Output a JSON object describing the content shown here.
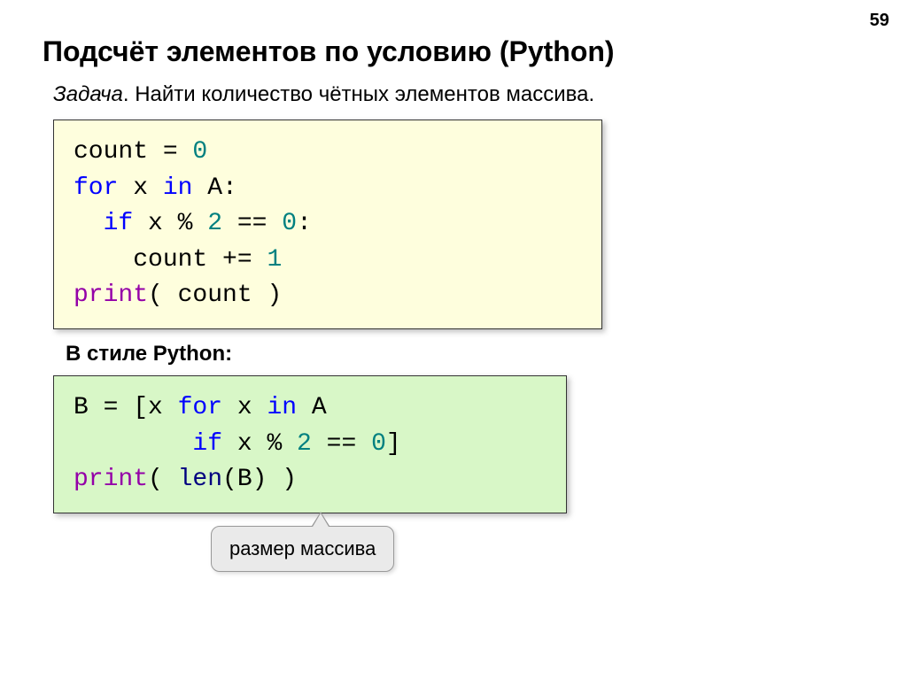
{
  "pageNumber": "59",
  "title": "Подсчёт элементов по условию (Python)",
  "taskLabel": "Задача",
  "taskText": ". Найти количество чётных элементов массива.",
  "subheading": "В стиле Python:",
  "callout": "размер массива",
  "code1": {
    "l1a": "count = ",
    "l1b": "0",
    "l2a": "for",
    "l2b": " x ",
    "l2c": "in",
    "l2d": " A:",
    "l3a": "  ",
    "l3b": "if",
    "l3c": " x % ",
    "l3d": "2",
    "l3e": " == ",
    "l3f": "0",
    "l3g": ":",
    "l4a": "    count += ",
    "l4b": "1",
    "l5a": "print",
    "l5b": "( count )"
  },
  "code2": {
    "l1a": "B = [x ",
    "l1b": "for",
    "l1c": " x ",
    "l1d": "in",
    "l1e": " A",
    "l2a": "        ",
    "l2b": "if",
    "l2c": " x % ",
    "l2d": "2",
    "l2e": " == ",
    "l2f": "0",
    "l2g": "]",
    "l3a": "print",
    "l3b": "( ",
    "l3c": "len",
    "l3d": "(B) )"
  }
}
